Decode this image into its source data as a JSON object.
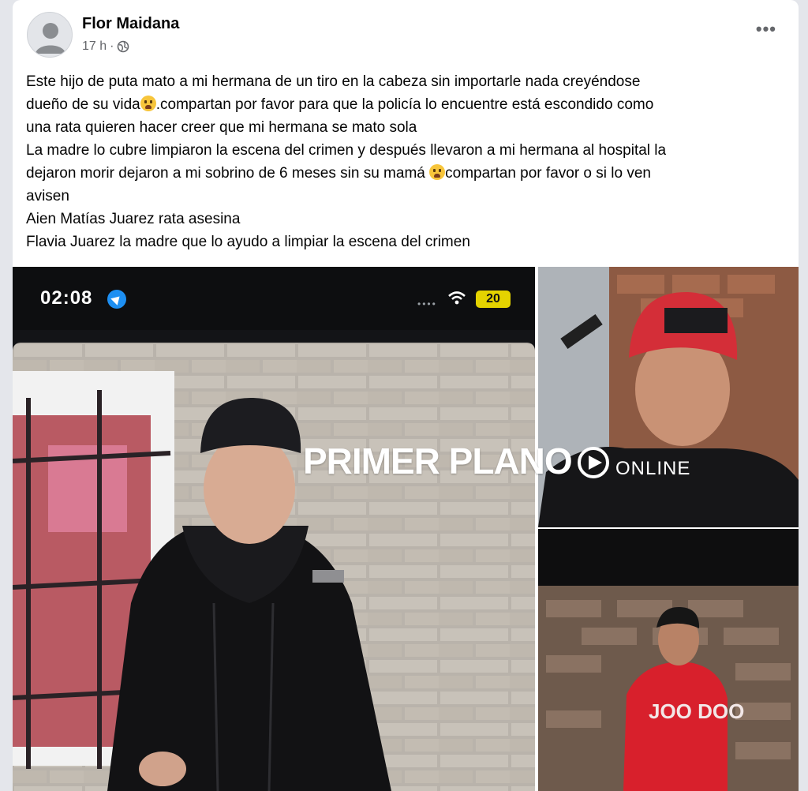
{
  "post": {
    "author": "Flor Maidana",
    "time": "17 h",
    "separator": "·",
    "audience_icon": "globe-icon",
    "more_label": "•••",
    "lines": [
      "Este hijo de puta mato a mi hermana de un tiro en la cabeza sin importarle nada creyéndose",
      "dueño de su vida",
      ".compartan por favor para que la policía lo encuentre está escondido como",
      "una rata quieren hacer creer que mi hermana se mato sola",
      "La madre lo cubre limpiaron la escena del crimen y después llevaron a mi hermana al hospital la",
      "dejaron morir dejaron a mi sobrino de 6 meses sin su mamá ",
      "compartan por favor o si lo ven",
      "avisen",
      "Aien Matías Juarez rata asesina",
      "Flavia Juarez la madre que lo ayudo a limpiar la escena del crimen"
    ],
    "emoji": "crying-face-emoji"
  },
  "phone": {
    "time": "02:08",
    "battery": "20",
    "location_icon": "location-arrow-icon",
    "wifi_icon": "wifi-icon"
  },
  "watermark": {
    "brand": "PRIMER PLANO",
    "sub": "ONLINE"
  },
  "colors": {
    "text": "#050505",
    "secondary": "#65676b",
    "battery": "#e4d300",
    "jacket_red": "#d8202c"
  }
}
